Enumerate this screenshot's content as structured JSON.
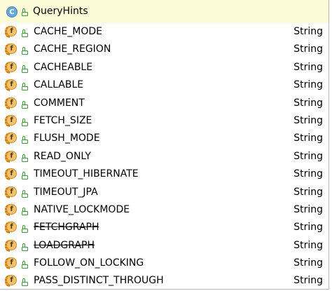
{
  "popup": {
    "header": {
      "class_icon_letter": "C",
      "title": "QueryHints"
    },
    "field_icon_letter": "f",
    "rows": [
      {
        "name": "CACHE_MODE",
        "type": "String",
        "deprecated": false
      },
      {
        "name": "CACHE_REGION",
        "type": "String",
        "deprecated": false
      },
      {
        "name": "CACHEABLE",
        "type": "String",
        "deprecated": false
      },
      {
        "name": "CALLABLE",
        "type": "String",
        "deprecated": false
      },
      {
        "name": "COMMENT",
        "type": "String",
        "deprecated": false
      },
      {
        "name": "FETCH_SIZE",
        "type": "String",
        "deprecated": false
      },
      {
        "name": "FLUSH_MODE",
        "type": "String",
        "deprecated": false
      },
      {
        "name": "READ_ONLY",
        "type": "String",
        "deprecated": false
      },
      {
        "name": "TIMEOUT_HIBERNATE",
        "type": "String",
        "deprecated": false
      },
      {
        "name": "TIMEOUT_JPA",
        "type": "String",
        "deprecated": false
      },
      {
        "name": "NATIVE_LOCKMODE",
        "type": "String",
        "deprecated": false
      },
      {
        "name": "FETCHGRAPH",
        "type": "String",
        "deprecated": true
      },
      {
        "name": "LOADGRAPH",
        "type": "String",
        "deprecated": true
      },
      {
        "name": "FOLLOW_ON_LOCKING",
        "type": "String",
        "deprecated": false
      },
      {
        "name": "PASS_DISTINCT_THROUGH",
        "type": "String",
        "deprecated": false
      }
    ]
  }
}
